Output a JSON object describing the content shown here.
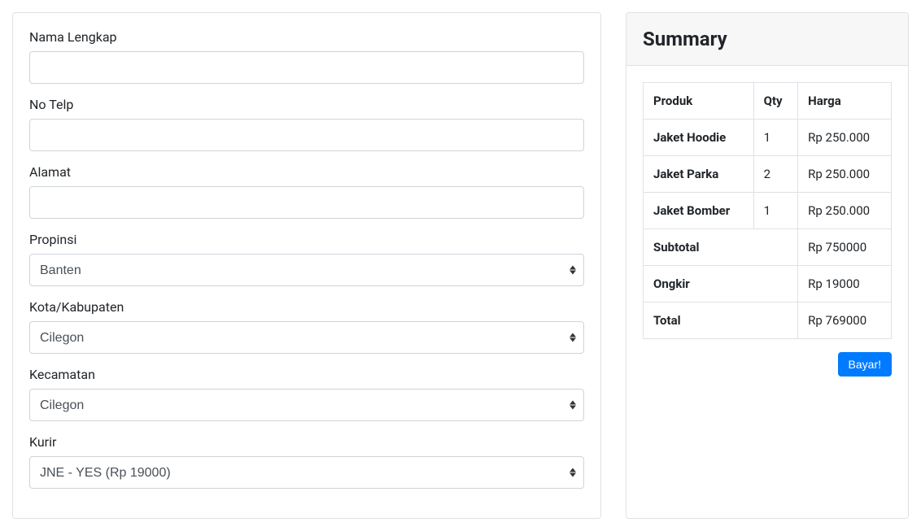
{
  "form": {
    "nama_label": "Nama Lengkap",
    "nama_value": "",
    "telp_label": "No Telp",
    "telp_value": "",
    "alamat_label": "Alamat",
    "alamat_value": "",
    "propinsi_label": "Propinsi",
    "propinsi_value": "Banten",
    "kota_label": "Kota/Kabupaten",
    "kota_value": "Cilegon",
    "kecamatan_label": "Kecamatan",
    "kecamatan_value": "Cilegon",
    "kurir_label": "Kurir",
    "kurir_value": "JNE - YES (Rp 19000)"
  },
  "summary": {
    "title": "Summary",
    "columns": {
      "produk": "Produk",
      "qty": "Qty",
      "harga": "Harga"
    },
    "items": [
      {
        "produk": "Jaket Hoodie",
        "qty": "1",
        "harga": "Rp 250.000"
      },
      {
        "produk": "Jaket Parka",
        "qty": "2",
        "harga": "Rp 250.000"
      },
      {
        "produk": "Jaket Bomber",
        "qty": "1",
        "harga": "Rp 250.000"
      }
    ],
    "subtotal_label": "Subtotal",
    "subtotal_value": "Rp 750000",
    "ongkir_label": "Ongkir",
    "ongkir_value": "Rp 19000",
    "total_label": "Total",
    "total_value": "Rp 769000",
    "pay_button": "Bayar!"
  }
}
